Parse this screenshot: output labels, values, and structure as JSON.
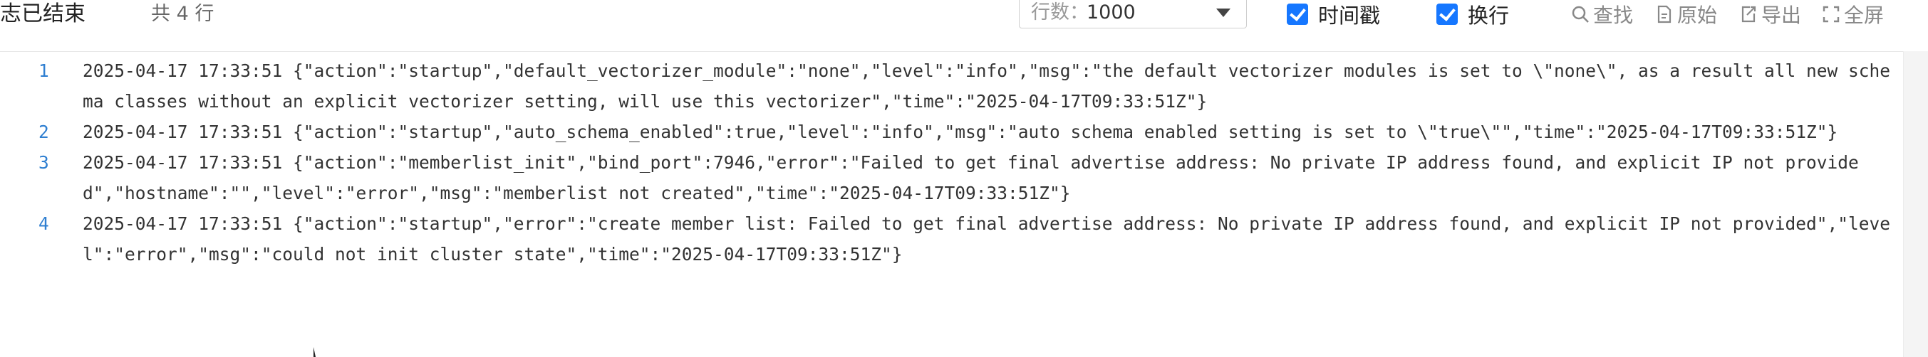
{
  "toolbar": {
    "title": "志已结束",
    "count_text": "共 4 行",
    "rows_label": "行数：",
    "rows_value": "1000",
    "timestamp_label": "时间戳",
    "wrap_label": "换行",
    "find_label": "查找",
    "raw_label": "原始",
    "export_label": "导出",
    "fullscreen_label": "全屏",
    "icons": [
      "search-icon",
      "document-icon",
      "export-icon",
      "fullscreen-icon"
    ],
    "accent_color": "#1677ff"
  },
  "log": {
    "lines": [
      {
        "num": "1",
        "text": "2025-04-17 17:33:51 {\"action\":\"startup\",\"default_vectorizer_module\":\"none\",\"level\":\"info\",\"msg\":\"the default vectorizer modules is set to \\\"none\\\", as a result all new schema classes without an explicit vectorizer setting, will use this vectorizer\",\"time\":\"2025-04-17T09:33:51Z\"}"
      },
      {
        "num": "2",
        "text": "2025-04-17 17:33:51 {\"action\":\"startup\",\"auto_schema_enabled\":true,\"level\":\"info\",\"msg\":\"auto schema enabled setting is set to \\\"true\\\"\",\"time\":\"2025-04-17T09:33:51Z\"}"
      },
      {
        "num": "3",
        "text": "2025-04-17 17:33:51 {\"action\":\"memberlist_init\",\"bind_port\":7946,\"error\":\"Failed to get final advertise address: No private IP address found, and explicit IP not provided\",\"hostname\":\"\",\"level\":\"error\",\"msg\":\"memberlist not created\",\"time\":\"2025-04-17T09:33:51Z\"}"
      },
      {
        "num": "4",
        "text": "2025-04-17 17:33:51 {\"action\":\"startup\",\"error\":\"create member list: Failed to get final advertise address: No private IP address found, and explicit IP not provided\",\"level\":\"error\",\"msg\":\"could not init cluster state\",\"time\":\"2025-04-17T09:33:51Z\"}"
      }
    ]
  }
}
